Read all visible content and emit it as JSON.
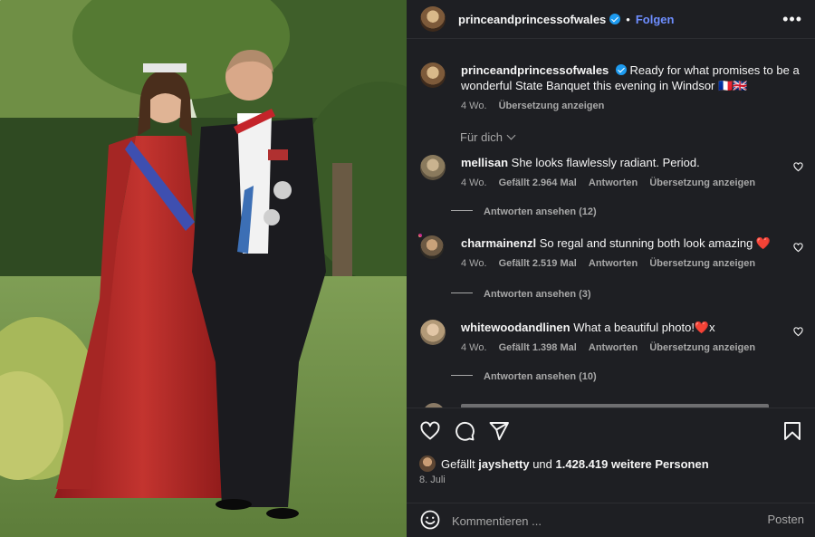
{
  "post": {
    "account": "princeandprincessofwales",
    "follow_label": "Folgen",
    "dot": "•",
    "more": "•••"
  },
  "caption": {
    "username": "princeandprincessofwales",
    "text": "Ready for what promises to be a wonderful State Banquet this evening in Windsor 🇫🇷🇬🇧",
    "age": "4 Wo.",
    "translate": "Übersetzung anzeigen"
  },
  "filter": {
    "label": "Für dich"
  },
  "comments": [
    {
      "username": "mellisan",
      "text": "She looks flawlessly radiant. Period.",
      "age": "4 Wo.",
      "likes": "Gefällt 2.964 Mal",
      "reply": "Antworten",
      "translate": "Übersetzung anzeigen",
      "view_replies": "Antworten ansehen (12)"
    },
    {
      "username": "charmainenzl",
      "text": "So regal and stunning both look amazing ❤️",
      "age": "4 Wo.",
      "likes": "Gefällt 2.519 Mal",
      "reply": "Antworten",
      "translate": "Übersetzung anzeigen",
      "view_replies": "Antworten ansehen (3)"
    },
    {
      "username": "whitewoodandlinen",
      "text": "What a beautiful photo!❤️x",
      "age": "4 Wo.",
      "likes": "Gefällt 1.398 Mal",
      "reply": "Antworten",
      "translate": "Übersetzung anzeigen",
      "view_replies": "Antworten ansehen (10)"
    }
  ],
  "likes_line": {
    "prefix": "Gefällt",
    "user": "jayshetty",
    "connector": "und",
    "others": "1.428.419 weitere Personen"
  },
  "date": "8. Juli",
  "composer": {
    "placeholder": "Kommentieren ...",
    "post_label": "Posten"
  },
  "icons": {
    "like": "heart-icon",
    "comment": "comment-icon",
    "share": "send-icon",
    "save": "bookmark-icon",
    "emoji": "emoji-icon",
    "more": "more-icon",
    "verified": "verified-badge-icon"
  },
  "colors": {
    "panel_bg": "#1e1f23",
    "link_blue": "#6e8eff",
    "verified_blue": "#1d9bf0",
    "muted_text": "#a8a8a8"
  }
}
